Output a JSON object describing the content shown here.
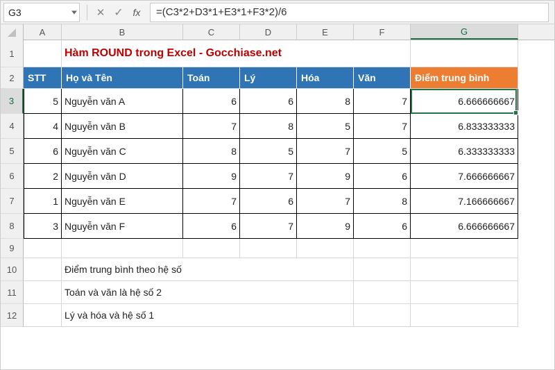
{
  "name_box": "G3",
  "formula": "=(C3*2+D3*1+E3*1+F3*2)/6",
  "columns": [
    "A",
    "B",
    "C",
    "D",
    "E",
    "F",
    "G"
  ],
  "title": "Hàm ROUND trong Excel  - Gocchiase.net",
  "headers": {
    "stt": "STT",
    "hoten": "Họ và Tên",
    "toan": "Toán",
    "ly": "Lý",
    "hoa": "Hóa",
    "van": "Văn",
    "dtb": "Điểm trung bình"
  },
  "rows": [
    {
      "stt": "5",
      "name": "Nguyễn văn A",
      "toan": "6",
      "ly": "6",
      "hoa": "8",
      "van": "7",
      "dtb": "6.666666667"
    },
    {
      "stt": "4",
      "name": "Nguyễn văn B",
      "toan": "7",
      "ly": "8",
      "hoa": "5",
      "van": "7",
      "dtb": "6.833333333"
    },
    {
      "stt": "6",
      "name": "Nguyễn văn C",
      "toan": "8",
      "ly": "5",
      "hoa": "7",
      "van": "5",
      "dtb": "6.333333333"
    },
    {
      "stt": "2",
      "name": "Nguyễn văn D",
      "toan": "9",
      "ly": "7",
      "hoa": "9",
      "van": "6",
      "dtb": "7.666666667"
    },
    {
      "stt": "1",
      "name": "Nguyễn văn E",
      "toan": "7",
      "ly": "6",
      "hoa": "7",
      "van": "8",
      "dtb": "7.166666667"
    },
    {
      "stt": "3",
      "name": "Nguyễn văn F",
      "toan": "6",
      "ly": "7",
      "hoa": "9",
      "van": "6",
      "dtb": "6.666666667"
    }
  ],
  "notes": {
    "n1": "Điểm trung bình theo hệ số",
    "n2": "Toán và văn là hệ số 2",
    "n3": "Lý và hóa và hệ số 1"
  },
  "row_labels": [
    "1",
    "2",
    "3",
    "4",
    "5",
    "6",
    "7",
    "8",
    "9",
    "10",
    "11",
    "12"
  ],
  "selected_cell": "G3"
}
